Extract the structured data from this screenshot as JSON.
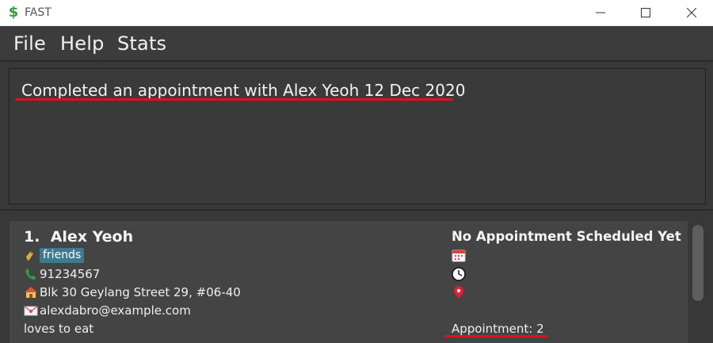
{
  "window": {
    "title": "FAST",
    "app_icon": "dollar-sign-icon",
    "controls": [
      "minimize-icon",
      "maximize-icon",
      "close-icon"
    ]
  },
  "menu": {
    "items": [
      "File",
      "Help",
      "Stats"
    ]
  },
  "result": {
    "text": "Completed an appointment with Alex Yeoh 12 Dec 2020"
  },
  "persons": [
    {
      "index": "1.",
      "name": "Alex Yeoh",
      "tags": [
        "friends"
      ],
      "phone": "91234567",
      "address": "Blk 30 Geylang Street 29, #06-40",
      "email": "alexdabro@example.com",
      "remark": "loves to eat",
      "appointment_status": "No Appointment Scheduled Yet",
      "appointment_count": "Appointment: 2"
    }
  ],
  "colors": {
    "accent_underline": "#e3101c",
    "tag_bg": "#3e7b91",
    "background": "#383838"
  }
}
